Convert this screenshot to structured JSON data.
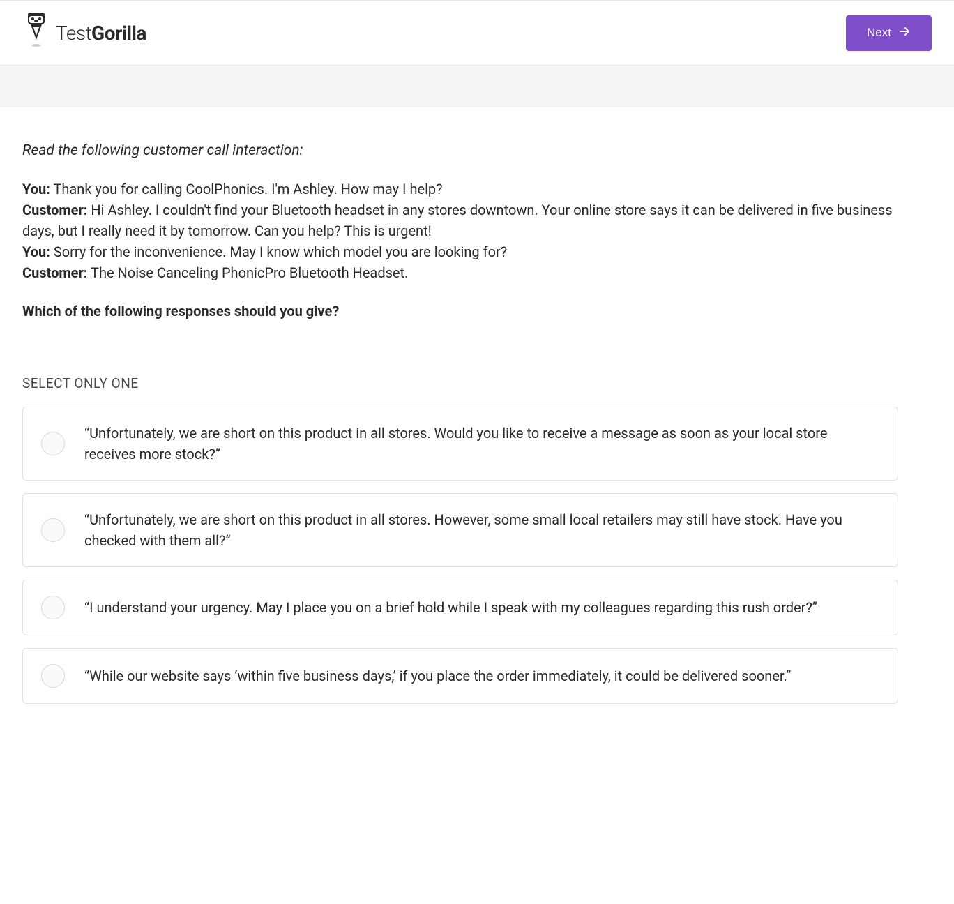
{
  "header": {
    "logo_thin": "Test",
    "logo_bold": "Gorilla",
    "next_label": "Next"
  },
  "content": {
    "instruction": "Read the following customer call interaction:",
    "dialogue": [
      {
        "speaker": "You:",
        "text": " Thank you for calling CoolPhonics. I'm Ashley. How may I help?"
      },
      {
        "speaker": "Customer:",
        "text": " Hi Ashley. I couldn't find your Bluetooth headset in any stores downtown. Your online store says it can be delivered in five business days, but I really need it by tomorrow. Can you help? This is urgent!"
      },
      {
        "speaker": "You:",
        "text": " Sorry for the inconvenience. May I know which model you are looking for?"
      },
      {
        "speaker": "Customer:",
        "text": " The Noise Canceling PhonicPro Bluetooth Headset."
      }
    ],
    "question": "Which of the following responses should you give?",
    "select_label": "SELECT ONLY ONE",
    "options": [
      "“Unfortunately, we are short on this product in all stores. Would you like to receive a message as soon as your local store receives more stock?”",
      "“Unfortunately, we are short on this product in all stores. However, some small local retailers may still have stock. Have you checked with them all?”",
      "“I understand your urgency. May I place you on a brief hold while I speak with my colleagues regarding this rush order?”",
      "“While our website says ‘within five business days,’ if you place the order immediately, it could be delivered sooner.”"
    ]
  }
}
